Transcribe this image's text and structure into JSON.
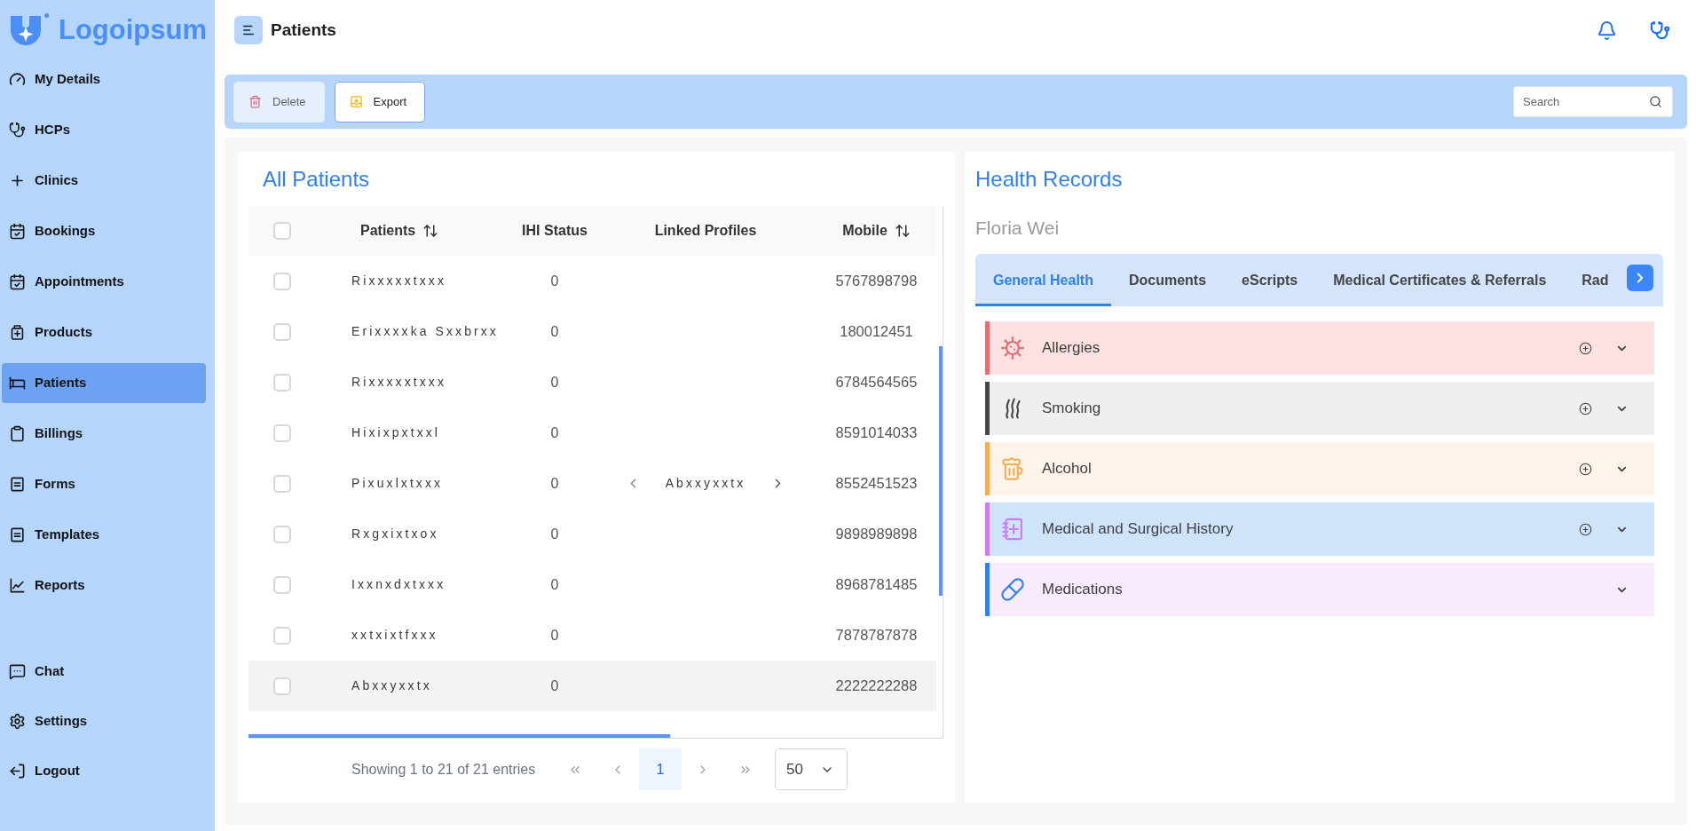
{
  "sidebar": {
    "logo": {
      "text": "Logoipsum"
    },
    "items": [
      {
        "label": "My Details",
        "selected": false
      },
      {
        "label": "HCPs",
        "selected": false
      },
      {
        "label": "Clinics",
        "selected": false
      },
      {
        "label": "Bookings",
        "selected": false
      },
      {
        "label": "Appointments",
        "selected": false
      },
      {
        "label": "Products",
        "selected": false
      },
      {
        "label": "Patients",
        "selected": true
      },
      {
        "label": "Billings",
        "selected": false
      },
      {
        "label": "Forms",
        "selected": false
      },
      {
        "label": "Templates",
        "selected": false
      },
      {
        "label": "Reports",
        "selected": false
      }
    ],
    "bottom_items": [
      {
        "label": "Chat",
        "selected": false
      },
      {
        "label": "Settings",
        "selected": false
      },
      {
        "label": "Logout",
        "selected": false
      }
    ]
  },
  "header": {
    "title": "Patients"
  },
  "toolbar": {
    "buttons": [
      {
        "kind": "delete",
        "label": "Delete",
        "disabled": true
      },
      {
        "kind": "export",
        "label": "Export",
        "disabled": false
      }
    ],
    "search": {
      "placeholder": "Search"
    }
  },
  "patients_panel": {
    "title": "All Patients",
    "table": {
      "select_all": {
        "checked": false
      },
      "columns": [
        {
          "label": "Patients",
          "sortable": true
        },
        {
          "label": "IHI Status",
          "sortable": false
        },
        {
          "label": "Linked Profiles",
          "sortable": false
        },
        {
          "label": "Mobile",
          "sortable": true
        }
      ],
      "rows": [
        {
          "checked": false,
          "highlighted": false,
          "patient": "Rixxxxxtxxx",
          "ihi_status": "0",
          "mobile": "5767898798"
        },
        {
          "checked": false,
          "highlighted": false,
          "patient": "Erixxxxka Sxxbrxx",
          "ihi_status": "0",
          "mobile": "180012451"
        },
        {
          "checked": false,
          "highlighted": false,
          "patient": "Rixxxxxtxxx",
          "ihi_status": "0",
          "mobile": "6784564565"
        },
        {
          "checked": false,
          "highlighted": false,
          "patient": "Hixixpxtxxl",
          "ihi_status": "0",
          "mobile": "8591014033"
        },
        {
          "checked": false,
          "highlighted": false,
          "patient": "Pixuxlxtxxx",
          "ihi_status": "0",
          "linked_profile": "Abxxyxxtx",
          "mobile": "8552451523"
        },
        {
          "checked": false,
          "highlighted": false,
          "patient": "Rxgxixtxox",
          "ihi_status": "0",
          "mobile": "9898989898"
        },
        {
          "checked": false,
          "highlighted": false,
          "patient": "Ixxnxdxtxxx",
          "ihi_status": "0",
          "mobile": "8968781485"
        },
        {
          "checked": false,
          "highlighted": false,
          "patient": "xxtxixtfxxx",
          "ihi_status": "0",
          "mobile": "7878787878"
        },
        {
          "checked": false,
          "highlighted": true,
          "patient": "Abxxyxxtx",
          "ihi_status": "0",
          "mobile": "2222222288"
        }
      ]
    },
    "pagination": {
      "summary": "Showing 1 to 21 of 21 entries",
      "pages": [
        {
          "label": "1",
          "selected": true
        }
      ],
      "page_size": "50"
    }
  },
  "health_records": {
    "title": "Health Records",
    "patient_name": "Floria Wei",
    "tabs": [
      {
        "label": "General Health",
        "selected": true
      },
      {
        "label": "Documents",
        "selected": false
      },
      {
        "label": "eScripts",
        "selected": false
      },
      {
        "label": "Medical Certificates & Referrals",
        "selected": false
      },
      {
        "label": "Rad",
        "selected": false
      }
    ],
    "sections": [
      {
        "label": "Allergies",
        "color": "#e07070",
        "can_add": true
      },
      {
        "label": "Smoking",
        "color": "#474747",
        "can_add": true
      },
      {
        "label": "Alcohol",
        "color": "#f5ad55",
        "can_add": true
      },
      {
        "label": "Medical and Surgical History",
        "color": "#d27af0",
        "can_add": true
      },
      {
        "label": "Medications",
        "color": "#2f7ff0",
        "can_add": false
      }
    ]
  }
}
